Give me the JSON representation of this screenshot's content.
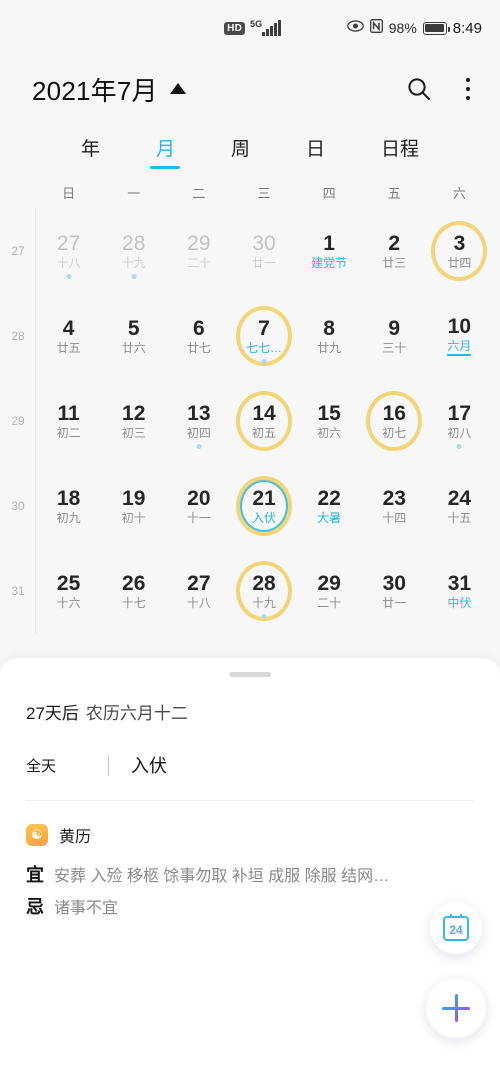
{
  "status_bar": {
    "hd_label": "HD",
    "network_label": "5G",
    "signal_icon": "signal-bars-icon",
    "eye_icon": "eye-icon",
    "nfc_icon": "nfc-icon",
    "battery_percent": "98%",
    "battery_icon": "battery-icon",
    "time": "8:49"
  },
  "header": {
    "title": "2021年7月",
    "caret_icon": "caret-up-icon",
    "search_icon": "search-icon",
    "more_icon": "more-vertical-icon"
  },
  "tabs": [
    {
      "label": "年",
      "active": false
    },
    {
      "label": "月",
      "active": true
    },
    {
      "label": "周",
      "active": false
    },
    {
      "label": "日",
      "active": false
    },
    {
      "label": "日程",
      "active": false
    }
  ],
  "weekdays": [
    "日",
    "一",
    "二",
    "三",
    "四",
    "五",
    "六"
  ],
  "colors": {
    "accent_blue": "#29b6e8",
    "ring_yellow": "#f3d577",
    "selected_ring": "#45c0dc",
    "event_dot": "#a9dcf0",
    "muted_text": "#c3c3c3"
  },
  "weeks": [
    {
      "week_number": "27",
      "days": [
        {
          "num": "27",
          "lunar": "十八",
          "muted": true,
          "ring": false,
          "selected": false,
          "dot": true,
          "accent": false,
          "underline": false
        },
        {
          "num": "28",
          "lunar": "十九",
          "muted": true,
          "ring": false,
          "selected": false,
          "dot": true,
          "accent": false,
          "underline": false
        },
        {
          "num": "29",
          "lunar": "二十",
          "muted": true,
          "ring": false,
          "selected": false,
          "dot": false,
          "accent": false,
          "underline": false
        },
        {
          "num": "30",
          "lunar": "廿一",
          "muted": true,
          "ring": false,
          "selected": false,
          "dot": false,
          "accent": false,
          "underline": false
        },
        {
          "num": "1",
          "lunar": "建党节",
          "muted": false,
          "ring": false,
          "selected": false,
          "dot": false,
          "accent": true,
          "underline": false
        },
        {
          "num": "2",
          "lunar": "廿三",
          "muted": false,
          "ring": false,
          "selected": false,
          "dot": false,
          "accent": false,
          "underline": false
        },
        {
          "num": "3",
          "lunar": "廿四",
          "muted": false,
          "ring": true,
          "selected": false,
          "dot": false,
          "accent": false,
          "underline": false
        }
      ]
    },
    {
      "week_number": "28",
      "days": [
        {
          "num": "4",
          "lunar": "廿五",
          "muted": false,
          "ring": false,
          "selected": false,
          "dot": false,
          "accent": false,
          "underline": false
        },
        {
          "num": "5",
          "lunar": "廿六",
          "muted": false,
          "ring": false,
          "selected": false,
          "dot": false,
          "accent": false,
          "underline": false
        },
        {
          "num": "6",
          "lunar": "廿七",
          "muted": false,
          "ring": false,
          "selected": false,
          "dot": false,
          "accent": false,
          "underline": false
        },
        {
          "num": "7",
          "lunar": "七七…",
          "muted": false,
          "ring": true,
          "selected": false,
          "dot": true,
          "accent": true,
          "underline": false
        },
        {
          "num": "8",
          "lunar": "廿九",
          "muted": false,
          "ring": false,
          "selected": false,
          "dot": false,
          "accent": false,
          "underline": false
        },
        {
          "num": "9",
          "lunar": "三十",
          "muted": false,
          "ring": false,
          "selected": false,
          "dot": false,
          "accent": false,
          "underline": false
        },
        {
          "num": "10",
          "lunar": "六月",
          "muted": false,
          "ring": false,
          "selected": false,
          "dot": false,
          "accent": true,
          "underline": true
        }
      ]
    },
    {
      "week_number": "29",
      "days": [
        {
          "num": "11",
          "lunar": "初二",
          "muted": false,
          "ring": false,
          "selected": false,
          "dot": false,
          "accent": false,
          "underline": false
        },
        {
          "num": "12",
          "lunar": "初三",
          "muted": false,
          "ring": false,
          "selected": false,
          "dot": false,
          "accent": false,
          "underline": false
        },
        {
          "num": "13",
          "lunar": "初四",
          "muted": false,
          "ring": false,
          "selected": false,
          "dot": true,
          "accent": false,
          "underline": false
        },
        {
          "num": "14",
          "lunar": "初五",
          "muted": false,
          "ring": true,
          "selected": false,
          "dot": false,
          "accent": false,
          "underline": false
        },
        {
          "num": "15",
          "lunar": "初六",
          "muted": false,
          "ring": false,
          "selected": false,
          "dot": false,
          "accent": false,
          "underline": false
        },
        {
          "num": "16",
          "lunar": "初七",
          "muted": false,
          "ring": true,
          "selected": false,
          "dot": false,
          "accent": false,
          "underline": false
        },
        {
          "num": "17",
          "lunar": "初八",
          "muted": false,
          "ring": false,
          "selected": false,
          "dot": true,
          "accent": false,
          "underline": false
        }
      ]
    },
    {
      "week_number": "30",
      "days": [
        {
          "num": "18",
          "lunar": "初九",
          "muted": false,
          "ring": false,
          "selected": false,
          "dot": false,
          "accent": false,
          "underline": false
        },
        {
          "num": "19",
          "lunar": "初十",
          "muted": false,
          "ring": false,
          "selected": false,
          "dot": false,
          "accent": false,
          "underline": false
        },
        {
          "num": "20",
          "lunar": "十一",
          "muted": false,
          "ring": false,
          "selected": false,
          "dot": false,
          "accent": false,
          "underline": false
        },
        {
          "num": "21",
          "lunar": "入伏",
          "muted": false,
          "ring": true,
          "selected": true,
          "dot": false,
          "accent": true,
          "underline": false
        },
        {
          "num": "22",
          "lunar": "大暑",
          "muted": false,
          "ring": false,
          "selected": false,
          "dot": false,
          "accent": true,
          "underline": false
        },
        {
          "num": "23",
          "lunar": "十四",
          "muted": false,
          "ring": false,
          "selected": false,
          "dot": false,
          "accent": false,
          "underline": false
        },
        {
          "num": "24",
          "lunar": "十五",
          "muted": false,
          "ring": false,
          "selected": false,
          "dot": false,
          "accent": false,
          "underline": false
        }
      ]
    },
    {
      "week_number": "31",
      "days": [
        {
          "num": "25",
          "lunar": "十六",
          "muted": false,
          "ring": false,
          "selected": false,
          "dot": false,
          "accent": false,
          "underline": false
        },
        {
          "num": "26",
          "lunar": "十七",
          "muted": false,
          "ring": false,
          "selected": false,
          "dot": false,
          "accent": false,
          "underline": false
        },
        {
          "num": "27",
          "lunar": "十八",
          "muted": false,
          "ring": false,
          "selected": false,
          "dot": false,
          "accent": false,
          "underline": false
        },
        {
          "num": "28",
          "lunar": "十九",
          "muted": false,
          "ring": true,
          "selected": false,
          "dot": true,
          "accent": false,
          "underline": false
        },
        {
          "num": "29",
          "lunar": "二十",
          "muted": false,
          "ring": false,
          "selected": false,
          "dot": false,
          "accent": false,
          "underline": false
        },
        {
          "num": "30",
          "lunar": "廿一",
          "muted": false,
          "ring": false,
          "selected": false,
          "dot": false,
          "accent": false,
          "underline": false
        },
        {
          "num": "31",
          "lunar": "中伏",
          "muted": false,
          "ring": false,
          "selected": false,
          "dot": false,
          "accent": true,
          "underline": false
        }
      ]
    }
  ],
  "sheet": {
    "relative_date": "27天后",
    "lunar_date": "农历六月十二",
    "all_day_label": "全天",
    "event_title": "入伏",
    "almanac": {
      "icon": "almanac-icon",
      "title": "黄历",
      "good_key": "宜",
      "good_value": "安葬 入殓 移柩 馀事勿取 补垣 成服 除服 结网…",
      "bad_key": "忌",
      "bad_value": "诸事不宜"
    }
  },
  "fabs": {
    "today_number": "24",
    "today_icon": "today-calendar-icon",
    "add_icon": "plus-icon"
  }
}
